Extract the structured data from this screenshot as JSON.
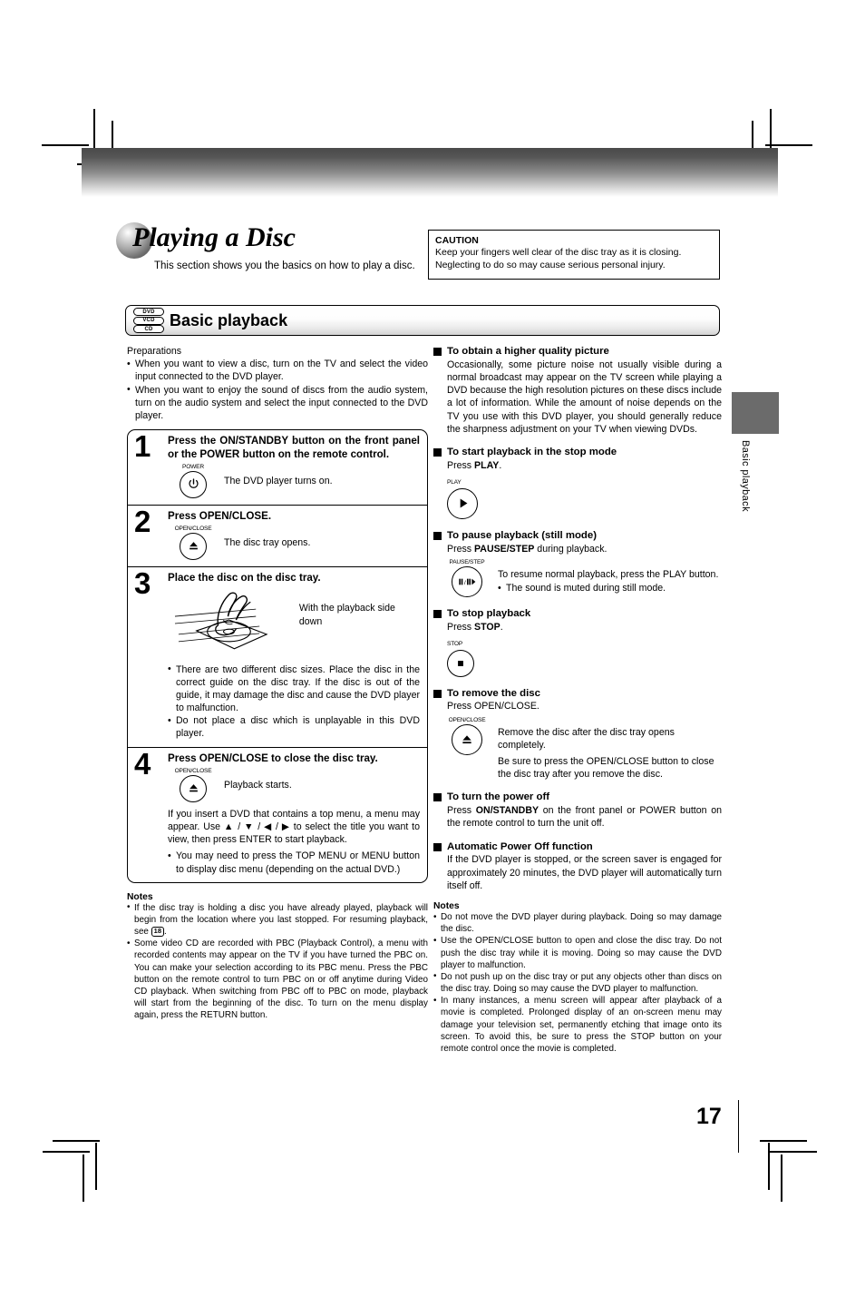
{
  "chapter": {
    "title": "Playing a Disc",
    "subtitle": "This section shows you the basics on how to play a disc."
  },
  "caution": {
    "title": "CAUTION",
    "line1": "Keep your fingers well clear of the disc tray as it is closing.",
    "line2": "Neglecting to do so may cause serious personal injury."
  },
  "banner": {
    "title": "Basic playback",
    "badges": [
      "DVD",
      "VCD",
      "CD"
    ]
  },
  "left": {
    "prep_title": "Preparations",
    "prep_bullets": [
      "When you want to view a disc, turn on the TV and select the video input connected to the DVD player.",
      "When you want to enjoy the sound of discs from the audio system, turn on the audio system and select the input connected to the DVD player."
    ],
    "steps": [
      {
        "num": "1",
        "head": "Press the ON/STANDBY button on the front panel or the POWER button on the remote control.",
        "key_label": "POWER",
        "key_icon": "power-icon",
        "text": "The DVD player turns on."
      },
      {
        "num": "2",
        "head": "Press OPEN/CLOSE.",
        "key_label": "OPEN/CLOSE",
        "key_icon": "eject-icon",
        "text": "The disc tray opens."
      },
      {
        "num": "3",
        "head": "Place the disc on the disc tray.",
        "caption": "With the playback side down",
        "bullets": [
          "There are two different disc sizes. Place the disc in the correct guide on the disc tray. If the disc is out of the guide, it may damage the disc and cause the DVD player to malfunction.",
          "Do not place a disc which is unplayable in this DVD player."
        ]
      },
      {
        "num": "4",
        "head": "Press OPEN/CLOSE to close the disc tray.",
        "key_label": "OPEN/CLOSE",
        "key_icon": "eject-icon",
        "text": "Playback starts.",
        "paragraph": "If you insert a DVD that contains a top menu, a menu may appear. Use ▲ / ▼ / ◀ / ▶ to select the title you want to view, then press ENTER to start playback.",
        "bullets": [
          "You may need to press the TOP MENU or MENU button to display disc menu (depending on the actual DVD.)"
        ]
      }
    ],
    "notes_title": "Notes",
    "notes": [
      "If the disc tray is holding a disc you have already played, playback will begin from the location where you last stopped. For resuming playback, see",
      "Some video CD are recorded with PBC (Playback Control), a menu with recorded contents may appear on the TV if you have turned the PBC on. You can make your selection according to its PBC menu. Press the PBC button on the remote control to turn PBC on or off anytime during Video CD playback. When switching from PBC off to PBC on mode, playback will start from the beginning of the disc. To turn on the menu display again, press the RETURN button."
    ],
    "note_pageref": "18"
  },
  "right": {
    "sections": [
      {
        "head": "To obtain a higher quality picture",
        "body": "Occasionally, some picture noise not usually visible during a normal broadcast may appear on the TV screen while playing a DVD because the high resolution pictures on these discs include a lot of information. While the amount of noise depends on the TV you use with this DVD player, you should generally reduce the sharpness adjustment on your TV when viewing DVDs."
      },
      {
        "head": "To start playback in the stop mode",
        "press_prefix": "Press ",
        "press_bold": "PLAY",
        "press_suffix": ".",
        "key_label": "PLAY",
        "key_icon": "play-icon"
      },
      {
        "head": "To pause playback (still mode)",
        "press_prefix": "Press ",
        "press_bold": "PAUSE/STEP",
        "press_suffix": " during playback.",
        "key_label": "PAUSE/STEP",
        "key_icon": "pause-step-icon",
        "text1": "To resume normal playback, press the PLAY button.",
        "bullet1": "The sound is muted during still mode."
      },
      {
        "head": "To stop playback",
        "press_prefix": "Press ",
        "press_bold": "STOP",
        "press_suffix": ".",
        "key_label": "STOP",
        "key_icon": "stop-icon"
      },
      {
        "head": "To remove the disc",
        "press_plain": "Press OPEN/CLOSE.",
        "key_label": "OPEN/CLOSE",
        "key_icon": "eject-icon",
        "text1": "Remove the disc after the disc tray opens completely.",
        "text2": "Be sure to press the OPEN/CLOSE button to close the disc tray after you remove the disc."
      },
      {
        "head": "To turn the power off",
        "press_prefix": "Press ",
        "press_bold": "ON/STANDBY",
        "press_suffix": " on the front panel or POWER button on the remote control to turn the unit off."
      },
      {
        "head": "Automatic Power Off function",
        "body": "If the DVD player is stopped, or the screen saver is engaged for approximately 20 minutes, the DVD player will automatically turn itself off."
      }
    ],
    "notes_title": "Notes",
    "notes": [
      "Do not move the DVD player during playback. Doing so may damage the disc.",
      "Use the OPEN/CLOSE button to open and close the disc tray. Do not push the disc tray while it is moving. Doing so may cause the DVD player to malfunction.",
      "Do not push up on the disc tray or put any objects other than discs on the disc tray. Doing so may cause the DVD player to malfunction.",
      "In many instances, a menu screen will appear after playback of a movie is completed. Prolonged display of an on-screen menu may damage your television set, permanently etching that image onto its screen. To avoid this, be sure to press the STOP button on your remote control once the movie is completed."
    ]
  },
  "side_tab": {
    "label": "Basic playback",
    "color": "#6b6b6b"
  },
  "page_number": "17"
}
